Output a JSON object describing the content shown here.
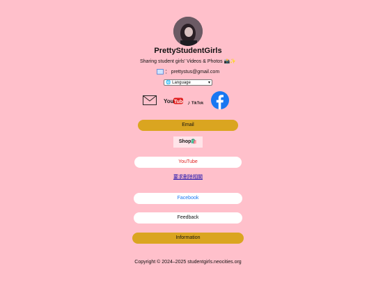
{
  "profile": {
    "name": "PrettyStudentGirls",
    "tagline": "Sharing student girls' Videos & Photos 📸✨",
    "email_prefix": "：",
    "email": "prettystus@gmail.com",
    "avatar_alt": "profile photo"
  },
  "language_select": {
    "label": "🌐 Language"
  },
  "social_icons": [
    {
      "icon": "envelope-icon",
      "label": ""
    },
    {
      "icon": "youtube-logo",
      "label": "YouTube"
    },
    {
      "icon": "tiktok-logo",
      "label": "TikTok"
    },
    {
      "icon": "facebook-logo",
      "label": ""
    }
  ],
  "buttons": {
    "email": "Email",
    "shop": "Shop🛍️",
    "youtube": "YouTube",
    "removal_request": "要求刪除相關",
    "facebook": "Facebook",
    "feedback": "Feedback",
    "information": "Information"
  },
  "footer": {
    "copyright": "Copyright © 2024–2025 studentgirls.neocities.org"
  },
  "colors": {
    "background": "#ffc0cb",
    "gold": "#daa520",
    "youtube_red": "#e02020",
    "facebook_blue": "#1877f2",
    "link": "#1a0dab"
  }
}
